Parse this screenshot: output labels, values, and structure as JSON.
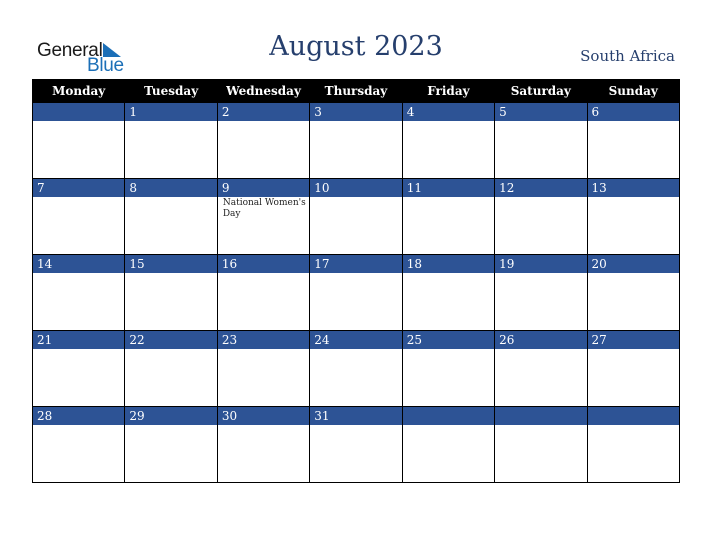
{
  "logo": {
    "general": "General",
    "blue": "Blue"
  },
  "title": "August 2023",
  "country": "South Africa",
  "colors": {
    "header_bg": "#000000",
    "date_band": "#2d5395",
    "title": "#263f6d",
    "logo_blue": "#1b6fb7"
  },
  "weekdays": [
    "Monday",
    "Tuesday",
    "Wednesday",
    "Thursday",
    "Friday",
    "Saturday",
    "Sunday"
  ],
  "weeks": [
    {
      "days": [
        "",
        "1",
        "2",
        "3",
        "4",
        "5",
        "6"
      ],
      "events": [
        "",
        "",
        "",
        "",
        "",
        "",
        ""
      ]
    },
    {
      "days": [
        "7",
        "8",
        "9",
        "10",
        "11",
        "12",
        "13"
      ],
      "events": [
        "",
        "",
        "National Women's Day",
        "",
        "",
        "",
        ""
      ]
    },
    {
      "days": [
        "14",
        "15",
        "16",
        "17",
        "18",
        "19",
        "20"
      ],
      "events": [
        "",
        "",
        "",
        "",
        "",
        "",
        ""
      ]
    },
    {
      "days": [
        "21",
        "22",
        "23",
        "24",
        "25",
        "26",
        "27"
      ],
      "events": [
        "",
        "",
        "",
        "",
        "",
        "",
        ""
      ]
    },
    {
      "days": [
        "28",
        "29",
        "30",
        "31",
        "",
        "",
        ""
      ],
      "events": [
        "",
        "",
        "",
        "",
        "",
        "",
        ""
      ]
    }
  ]
}
